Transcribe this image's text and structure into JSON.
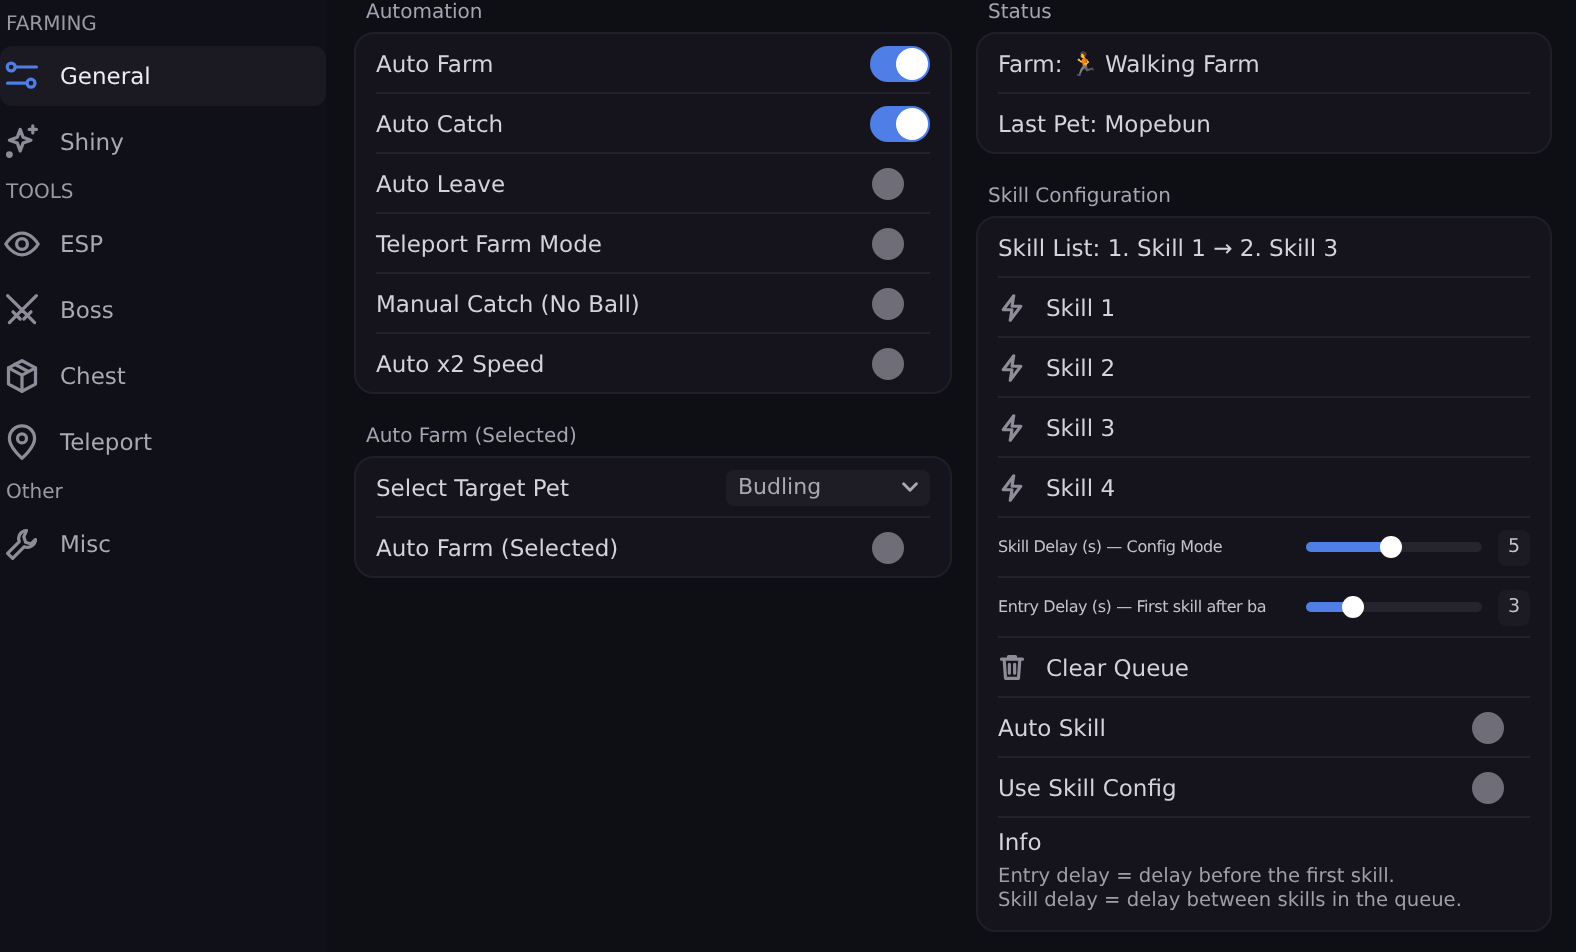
{
  "sidebar": {
    "sections": [
      {
        "title": "FARMING",
        "items": [
          {
            "label": "General",
            "selected": true
          },
          {
            "label": "Shiny",
            "selected": false
          }
        ]
      },
      {
        "title": "TOOLS",
        "items": [
          {
            "label": "ESP",
            "selected": false
          },
          {
            "label": "Boss",
            "selected": false
          },
          {
            "label": "Chest",
            "selected": false
          },
          {
            "label": "Teleport",
            "selected": false
          }
        ]
      },
      {
        "title": "Other",
        "items": [
          {
            "label": "Misc",
            "selected": false
          }
        ]
      }
    ]
  },
  "columns": [
    [
      {
        "title": "Automation",
        "rows": [
          {
            "kind": "toggle",
            "label": "Auto Farm",
            "on": true
          },
          {
            "kind": "toggle",
            "label": "Auto Catch",
            "on": true
          },
          {
            "kind": "toggle",
            "label": "Auto Leave",
            "on": false
          },
          {
            "kind": "toggle",
            "label": "Teleport Farm Mode",
            "on": false
          },
          {
            "kind": "toggle",
            "label": "Manual Catch (No Ball)",
            "on": false
          },
          {
            "kind": "toggle",
            "label": "Auto x2 Speed",
            "on": false
          }
        ]
      },
      {
        "title": "Auto Farm (Selected)",
        "rows": [
          {
            "kind": "select",
            "label": "Select Target Pet",
            "value": "Budling"
          },
          {
            "kind": "toggle",
            "label": "Auto Farm (Selected)",
            "on": false
          }
        ]
      }
    ],
    [
      {
        "title": "Status",
        "rows": [
          {
            "kind": "status",
            "label": "Farm: 🏃 Walking Farm"
          },
          {
            "kind": "status",
            "label": "Last Pet: Mopebun"
          }
        ]
      },
      {
        "title": "Skill Configuration",
        "rows": [
          {
            "kind": "status",
            "label": "Skill List: 1. Skill 1 → 2. Skill 3"
          },
          {
            "kind": "skill",
            "label": "Skill 1"
          },
          {
            "kind": "skill",
            "label": "Skill 2"
          },
          {
            "kind": "skill",
            "label": "Skill 3"
          },
          {
            "kind": "skill",
            "label": "Skill 4"
          },
          {
            "kind": "slider",
            "label": "Skill Delay (s) — Config Mode",
            "level": 0.48,
            "value": "5"
          },
          {
            "kind": "slider",
            "label": "Entry Delay (s) — First skill after ba",
            "level": 0.26,
            "value": "3"
          },
          {
            "kind": "action",
            "label": "Clear Queue"
          },
          {
            "kind": "toggle",
            "label": "Auto Skill",
            "on": false
          },
          {
            "kind": "toggle",
            "label": "Use Skill Config",
            "on": false
          },
          {
            "kind": "info",
            "label": "Info",
            "lines": [
              "Entry delay = delay before the first skill.",
              "Skill delay = delay between skills in the queue."
            ]
          }
        ]
      }
    ]
  ]
}
